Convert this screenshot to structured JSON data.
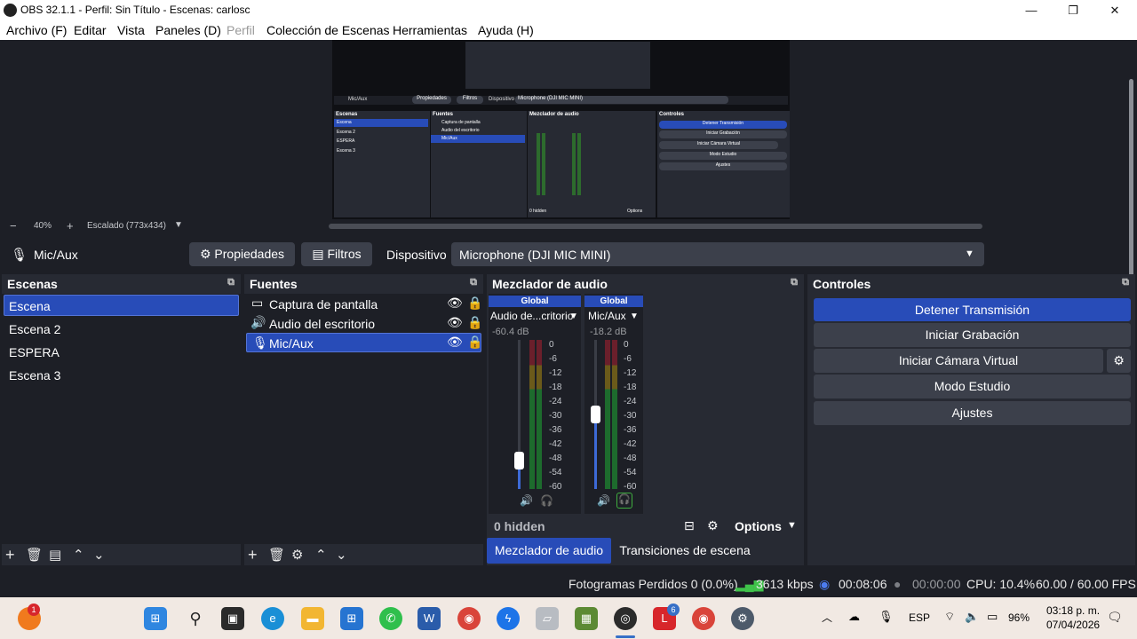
{
  "window": {
    "title": "OBS 32.1.1 - Perfil: Sin Título - Escenas: carlosc",
    "minimize": "—",
    "maximize": "❐",
    "close": "✕"
  },
  "menu": {
    "items": [
      "Archivo (F)",
      "Editar",
      "Vista",
      "Paneles (D)",
      "Perfil",
      "Colección de Escenas",
      "Herramientas",
      "Ayuda (H)"
    ]
  },
  "preview": {
    "zoom": "40%",
    "scaling": "Escalado (773x434)",
    "minus": "−",
    "plus": "+"
  },
  "mini_preview": {
    "source": "Mic/Aux",
    "props": "Propiedades",
    "filters": "Filtros",
    "device_label": "Dispositivo",
    "device": "Microphone (DJI MIC MINI)",
    "scenes_title": "Escenas",
    "scenes": [
      "Escena",
      "Escena 2",
      "ESPERA",
      "Escena 3"
    ],
    "sources_title": "Fuentes",
    "sources": [
      "Captura de pantalla",
      "Audio del escritorio",
      "Mic/Aux"
    ],
    "mixer_title": "Mezclador de audio",
    "controls_title": "Controles",
    "controls": [
      "Detener Transmisión",
      "Iniciar Grabación",
      "Iniciar Cámara Virtual",
      "Modo Estudio",
      "Ajustes"
    ],
    "hidden": "0 hidden",
    "options": "Options"
  },
  "device_bar": {
    "source_name": "Mic/Aux",
    "properties_label": "Propiedades",
    "filters_label": "Filtros",
    "device_label": "Dispositivo",
    "device_value": "Microphone (DJI MIC MINI)"
  },
  "scenes": {
    "title": "Escenas",
    "items": [
      "Escena",
      "Escena 2",
      "ESPERA",
      "Escena 3"
    ],
    "selected": "Escena"
  },
  "sources": {
    "title": "Fuentes",
    "items": [
      {
        "name": "Captura de pantalla",
        "icon": "monitor-icon"
      },
      {
        "name": "Audio del escritorio",
        "icon": "speaker-icon"
      },
      {
        "name": "Mic/Aux",
        "icon": "microphone-icon"
      }
    ],
    "selected": "Mic/Aux"
  },
  "mixer": {
    "title": "Mezclador de audio",
    "channels": [
      {
        "badge": "Global",
        "name": "Audio de...critorio",
        "level": "-60.4 dB",
        "fader_level": 0.18
      },
      {
        "badge": "Global",
        "name": "Mic/Aux",
        "level": "-18.2 dB",
        "fader_level": 0.52
      }
    ],
    "scale": [
      "0",
      "-6",
      "-12",
      "-18",
      "-24",
      "-30",
      "-36",
      "-42",
      "-48",
      "-54",
      "-60"
    ],
    "hidden": "0 hidden",
    "options": "Options",
    "tabs": [
      "Mezclador de audio",
      "Transiciones de escena"
    ]
  },
  "controls": {
    "title": "Controles",
    "stop_stream": "Detener Transmisión",
    "start_recording": "Iniciar Grabación",
    "start_virtual_cam": "Iniciar Cámara Virtual",
    "studio_mode": "Modo Estudio",
    "settings": "Ajustes"
  },
  "status": {
    "dropped_frames": "Fotogramas Perdidos 0 (0.0%)",
    "bitrate": "3613 kbps",
    "stream_time": "00:08:06",
    "record_time": "00:00:00",
    "cpu": "CPU: 10.4%",
    "fps": "60.00 / 60.00 FPS"
  },
  "taskbar": {
    "badge_firefox": "1",
    "badge_l": "6",
    "lang": "ESP",
    "battery": "96%",
    "time": "03:18 p. m.",
    "date": "07/04/2026"
  },
  "colors": {
    "background": "#1d1f26",
    "dock": "#272a33",
    "accent": "#284cb8",
    "button": "#3c404b"
  }
}
